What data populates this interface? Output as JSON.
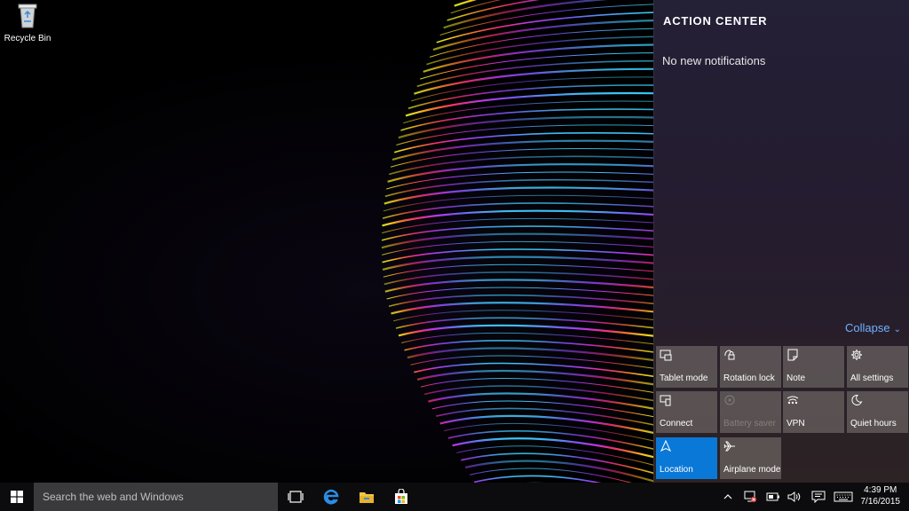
{
  "desktop": {
    "icons": [
      {
        "label": "Recycle Bin",
        "icon": "recycle-bin-icon"
      }
    ]
  },
  "action_center": {
    "title": "ACTION CENTER",
    "empty_message": "No new notifications",
    "collapse_label": "Collapse",
    "quick_actions": [
      {
        "label": "Tablet mode",
        "icon": "tablet-mode-icon",
        "state": "off"
      },
      {
        "label": "Rotation lock",
        "icon": "rotation-lock-icon",
        "state": "off"
      },
      {
        "label": "Note",
        "icon": "note-icon",
        "state": "off"
      },
      {
        "label": "All settings",
        "icon": "gear-icon",
        "state": "off"
      },
      {
        "label": "Connect",
        "icon": "connect-icon",
        "state": "off"
      },
      {
        "label": "Battery saver",
        "icon": "battery-saver-icon",
        "state": "disabled"
      },
      {
        "label": "VPN",
        "icon": "vpn-icon",
        "state": "off"
      },
      {
        "label": "Quiet hours",
        "icon": "moon-icon",
        "state": "off"
      },
      {
        "label": "Location",
        "icon": "location-icon",
        "state": "on"
      },
      {
        "label": "Airplane mode",
        "icon": "airplane-icon",
        "state": "off"
      }
    ]
  },
  "taskbar": {
    "search_placeholder": "Search the web and Windows",
    "apps": [
      {
        "name": "Task View",
        "icon": "task-view-icon"
      },
      {
        "name": "Microsoft Edge",
        "icon": "edge-icon"
      },
      {
        "name": "File Explorer",
        "icon": "folder-icon"
      },
      {
        "name": "Store",
        "icon": "store-icon"
      }
    ],
    "clock": {
      "time": "4:39 PM",
      "date": "7/16/2015"
    }
  },
  "colors": {
    "accent": "#0a78d7",
    "link": "#6fb2ff",
    "taskbar": "#0c0c0e",
    "search_box": "#3a3a3c"
  }
}
